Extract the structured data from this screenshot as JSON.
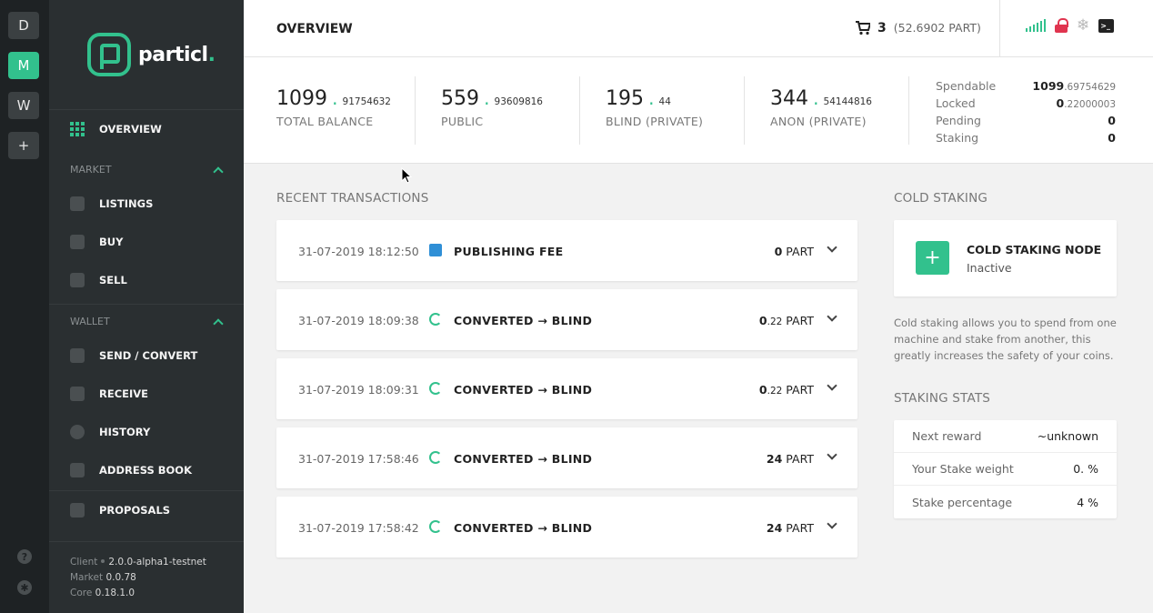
{
  "rail": {
    "buttons": [
      "D",
      "M",
      "W",
      "+"
    ]
  },
  "brand": {
    "name": "particl",
    "dot": "."
  },
  "sidebar": {
    "overview": "OVERVIEW",
    "market_section": "MARKET",
    "market_items": [
      "LISTINGS",
      "BUY",
      "SELL"
    ],
    "wallet_section": "WALLET",
    "wallet_items": [
      "SEND / CONVERT",
      "RECEIVE",
      "HISTORY",
      "ADDRESS BOOK"
    ],
    "proposals": "PROPOSALS",
    "footer": {
      "client_label": "Client",
      "client_value": "2.0.0-alpha1-testnet",
      "market_label": "Market",
      "market_value": "0.0.78",
      "core_label": "Core",
      "core_value": "0.18.1.0"
    }
  },
  "header": {
    "title": "OVERVIEW",
    "cart_count": "3",
    "cart_total": "(52.6902 PART)"
  },
  "balances": [
    {
      "int": "1099",
      "dec": "91754632",
      "label": "TOTAL BALANCE"
    },
    {
      "int": "559",
      "dec": "93609816",
      "label": "PUBLIC"
    },
    {
      "int": "195",
      "dec": "44",
      "label": "BLIND (PRIVATE)"
    },
    {
      "int": "344",
      "dec": "54144816",
      "label": "ANON (PRIVATE)"
    }
  ],
  "balance_table": [
    {
      "label": "Spendable",
      "int": "1099",
      "dec": ".69754629"
    },
    {
      "label": "Locked",
      "int": "0",
      "dec": ".22000003"
    },
    {
      "label": "Pending",
      "int": "0",
      "dec": ""
    },
    {
      "label": "Staking",
      "int": "0",
      "dec": ""
    }
  ],
  "transactions_title": "RECENT TRANSACTIONS",
  "transactions": [
    {
      "date": "31-07-2019 18:12:50",
      "icon": "fee-icon",
      "type": "PUBLISHING FEE",
      "int": "0",
      "dec": "",
      "unit": "PART"
    },
    {
      "date": "31-07-2019 18:09:38",
      "icon": "convert-icon",
      "type": "CONVERTED → BLIND",
      "int": "0",
      "dec": ".22",
      "unit": "PART"
    },
    {
      "date": "31-07-2019 18:09:31",
      "icon": "convert-icon",
      "type": "CONVERTED → BLIND",
      "int": "0",
      "dec": ".22",
      "unit": "PART"
    },
    {
      "date": "31-07-2019 17:58:46",
      "icon": "convert-icon",
      "type": "CONVERTED → BLIND",
      "int": "24",
      "dec": "",
      "unit": "PART"
    },
    {
      "date": "31-07-2019 17:58:42",
      "icon": "convert-icon",
      "type": "CONVERTED → BLIND",
      "int": "24",
      "dec": "",
      "unit": "PART"
    }
  ],
  "cold_staking": {
    "title": "COLD STAKING",
    "node_title": "COLD STAKING NODE",
    "node_status": "Inactive",
    "description": "Cold staking allows you to spend from one machine and stake from another, this greatly increases the safety of your coins."
  },
  "staking_stats": {
    "title": "STAKING STATS",
    "rows": [
      {
        "label": "Next reward",
        "value": "~unknown"
      },
      {
        "label": "Your Stake weight",
        "value": "0. %"
      },
      {
        "label": "Stake percentage",
        "value": "4 %"
      }
    ]
  },
  "colors": {
    "accent": "#32c18d",
    "sidebar": "#2a2f31",
    "rail": "#1e2224",
    "lock": "#e0344f",
    "fee": "#2f8fd6"
  }
}
